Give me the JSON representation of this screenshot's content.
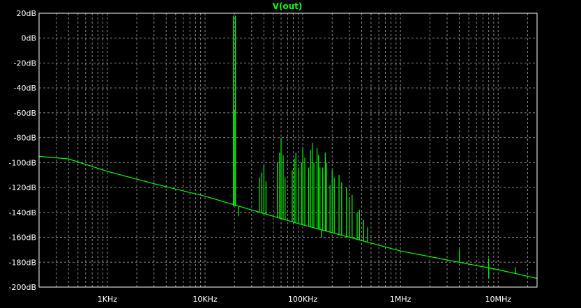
{
  "chart_data": {
    "type": "line",
    "title": "V(out)",
    "xscale": "log",
    "x_range_hz": [
      200,
      25000000
    ],
    "y_range_db": [
      -200,
      20
    ],
    "grid": "on",
    "y_ticks": [
      "20dB",
      "0dB",
      "-20dB",
      "-40dB",
      "-60dB",
      "-80dB",
      "-100dB",
      "-120dB",
      "-140dB",
      "-160dB",
      "-180dB",
      "-200dB"
    ],
    "y_tick_values": [
      20,
      0,
      -20,
      -40,
      -60,
      -80,
      -100,
      -120,
      -140,
      -160,
      -180,
      -200
    ],
    "x_ticks": [
      "1KHz",
      "10KHz",
      "100KHz",
      "1MHz",
      "10MHz"
    ],
    "x_tick_values": [
      1000,
      10000,
      100000,
      1000000,
      10000000
    ],
    "series": [
      {
        "color": "#00ff00",
        "baseline": [
          [
            200,
            -95
          ],
          [
            400,
            -97
          ],
          [
            1000,
            -107
          ],
          [
            3000,
            -117
          ],
          [
            10000,
            -127
          ],
          [
            20000,
            -134
          ],
          [
            100000,
            -150
          ],
          [
            300000,
            -160
          ],
          [
            1000000,
            -171
          ],
          [
            10000000,
            -186
          ],
          [
            25000000,
            -193
          ]
        ],
        "spikes": [
          [
            19500,
            18
          ],
          [
            19500,
            -135
          ],
          [
            20500,
            18
          ],
          [
            20500,
            -135
          ],
          [
            20000,
            -58
          ],
          [
            22000,
            -143
          ],
          [
            36000,
            -112
          ],
          [
            38000,
            -108
          ],
          [
            40000,
            -102
          ],
          [
            42000,
            -115
          ],
          [
            55000,
            -100
          ],
          [
            58000,
            -92
          ],
          [
            60000,
            -80
          ],
          [
            63000,
            -94
          ],
          [
            66000,
            -112
          ],
          [
            78000,
            -106
          ],
          [
            82000,
            -97
          ],
          [
            85000,
            -92
          ],
          [
            90000,
            -104
          ],
          [
            97000,
            -100
          ],
          [
            100000,
            -88
          ],
          [
            105000,
            -96
          ],
          [
            115000,
            -104
          ],
          [
            120000,
            -90
          ],
          [
            125000,
            -84
          ],
          [
            130000,
            -100
          ],
          [
            140000,
            -88
          ],
          [
            145000,
            -94
          ],
          [
            150000,
            -104
          ],
          [
            155000,
            -160
          ],
          [
            160000,
            -104
          ],
          [
            170000,
            -92
          ],
          [
            175000,
            -100
          ],
          [
            190000,
            -118
          ],
          [
            200000,
            -106
          ],
          [
            210000,
            -112
          ],
          [
            235000,
            -110
          ],
          [
            250000,
            -116
          ],
          [
            280000,
            -120
          ],
          [
            300000,
            -128
          ],
          [
            320000,
            -126
          ],
          [
            360000,
            -140
          ],
          [
            380000,
            -138
          ],
          [
            420000,
            -146
          ],
          [
            460000,
            -152
          ],
          [
            4000000,
            -170
          ],
          [
            8000000,
            -177
          ],
          [
            8000000,
            -193
          ],
          [
            15000000,
            -184
          ]
        ]
      }
    ]
  }
}
